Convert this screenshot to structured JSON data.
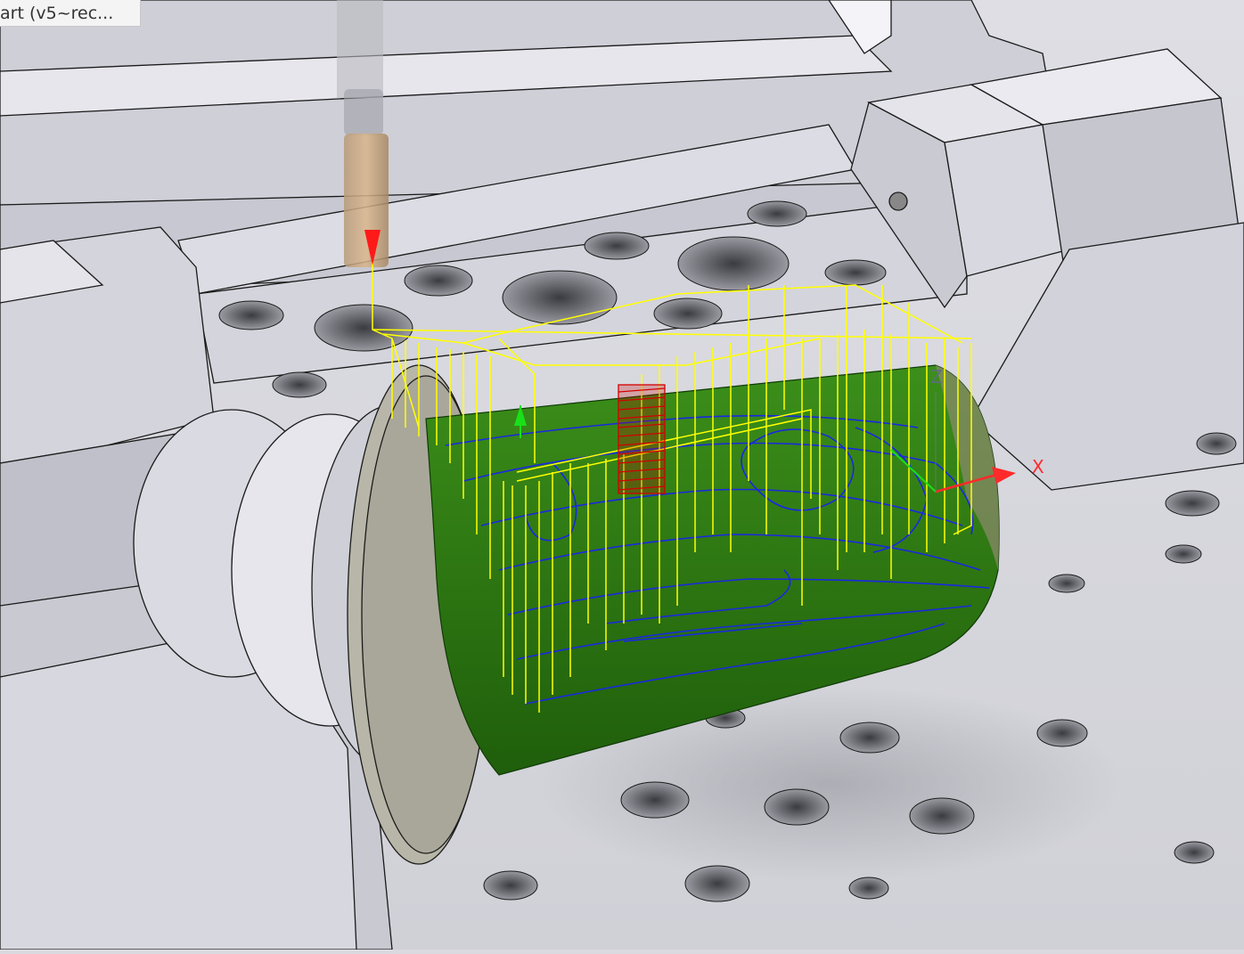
{
  "document": {
    "tab_label": "art (v5~rec..."
  },
  "triad": {
    "x_label": "X",
    "z_label": "Z"
  },
  "colors": {
    "fixture": "#d6d6de",
    "table": "#dcdce2",
    "stock": "#2f7d12",
    "toolpath_link": "#ffff00",
    "toolpath_cut": "#1a28e0",
    "drill_helix": "#d40000",
    "tool": "#c8a070",
    "x_axis": "#ff2a2a",
    "y_axis": "#19e019"
  },
  "icons": {
    "tool": "cutting-tool-icon",
    "start_marker": "toolpath-start-arrow-icon"
  }
}
